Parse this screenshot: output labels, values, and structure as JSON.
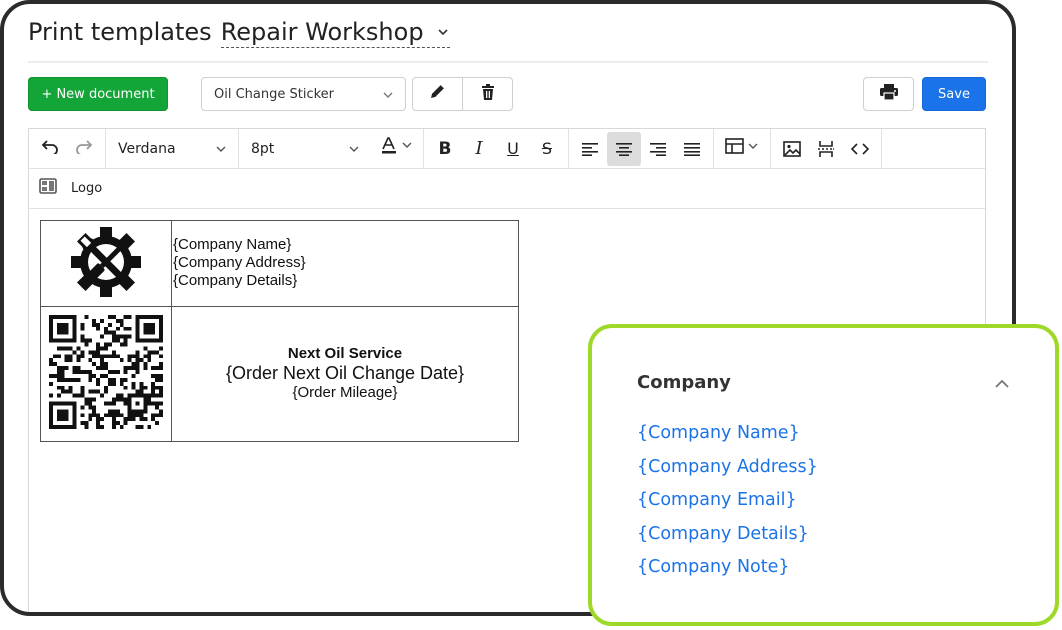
{
  "header": {
    "title": "Print templates",
    "workshop": "Repair Workshop"
  },
  "actions": {
    "new_document": "+ New document",
    "template_selected": "Oil Change Sticker",
    "save": "Save"
  },
  "toolbar": {
    "font_family": "Verdana",
    "font_size": "8pt"
  },
  "breadcrumb": {
    "label": "Logo"
  },
  "document": {
    "company_lines": [
      "{Company Name}",
      "{Company Address}",
      "{Company Details}"
    ],
    "service_title": "Next Oil Service",
    "service_date": "{Order Next Oil Change Date}",
    "service_mileage": "{Order Mileage}"
  },
  "panel": {
    "title": "Company",
    "items": [
      "{Company Name}",
      "{Company Address}",
      "{Company Email}",
      "{Company Details}",
      "{Company Note}"
    ]
  },
  "colors": {
    "primary": "#1a73e8",
    "success": "#13a538",
    "highlight_border": "#9ed829"
  }
}
